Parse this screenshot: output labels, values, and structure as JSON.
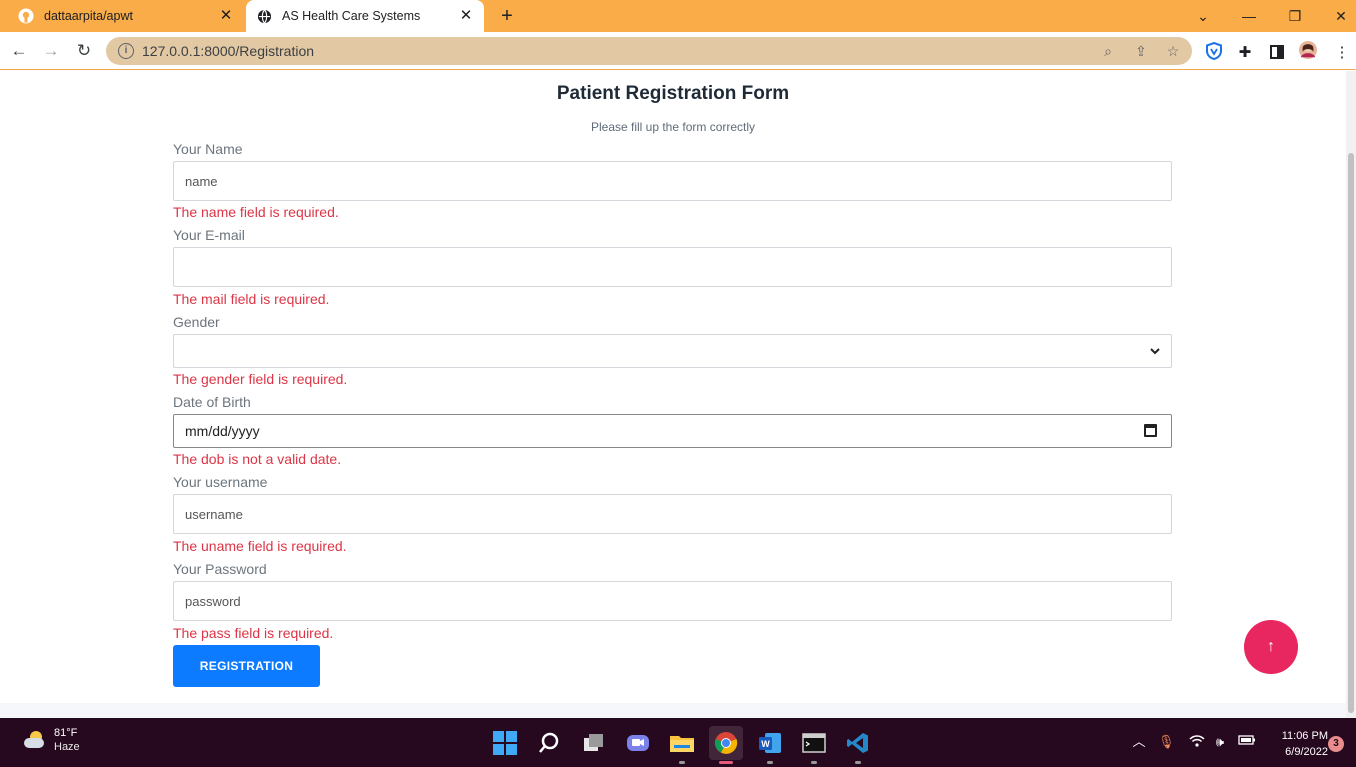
{
  "browser": {
    "tabs": [
      {
        "title": "dattaarpita/apwt",
        "favicon": "github-icon"
      },
      {
        "title": "AS Health Care Systems",
        "favicon": "globe-icon",
        "active": true
      }
    ],
    "url": "127.0.0.1:8000/Registration"
  },
  "form": {
    "title": "Patient Registration Form",
    "subtitle": "Please fill up the form correctly",
    "name": {
      "label": "Your Name",
      "placeholder": "name",
      "error": "The name field is required."
    },
    "email": {
      "label": "Your E-mail",
      "placeholder": "",
      "error": "The mail field is required."
    },
    "gender": {
      "label": "Gender",
      "value": "",
      "error": "The gender field is required."
    },
    "dob": {
      "label": "Date of Birth",
      "placeholder": "mm/dd/yyyy",
      "error": "The dob is not a valid date."
    },
    "username": {
      "label": "Your username",
      "placeholder": "username",
      "error": "The uname field is required."
    },
    "password": {
      "label": "Your Password",
      "placeholder": "password",
      "error": "The pass field is required."
    },
    "submit_label": "REGISTRATION"
  },
  "colors": {
    "tabbar": "#f9ac47",
    "error": "#dc3545",
    "submit": "#0d7bff",
    "back_to_top": "#e8265f",
    "taskbar": "#27091f"
  },
  "taskbar": {
    "weather": {
      "temp": "81°F",
      "condition": "Haze"
    },
    "time": "11:06 PM",
    "date": "6/9/2022",
    "notifications": "3"
  }
}
